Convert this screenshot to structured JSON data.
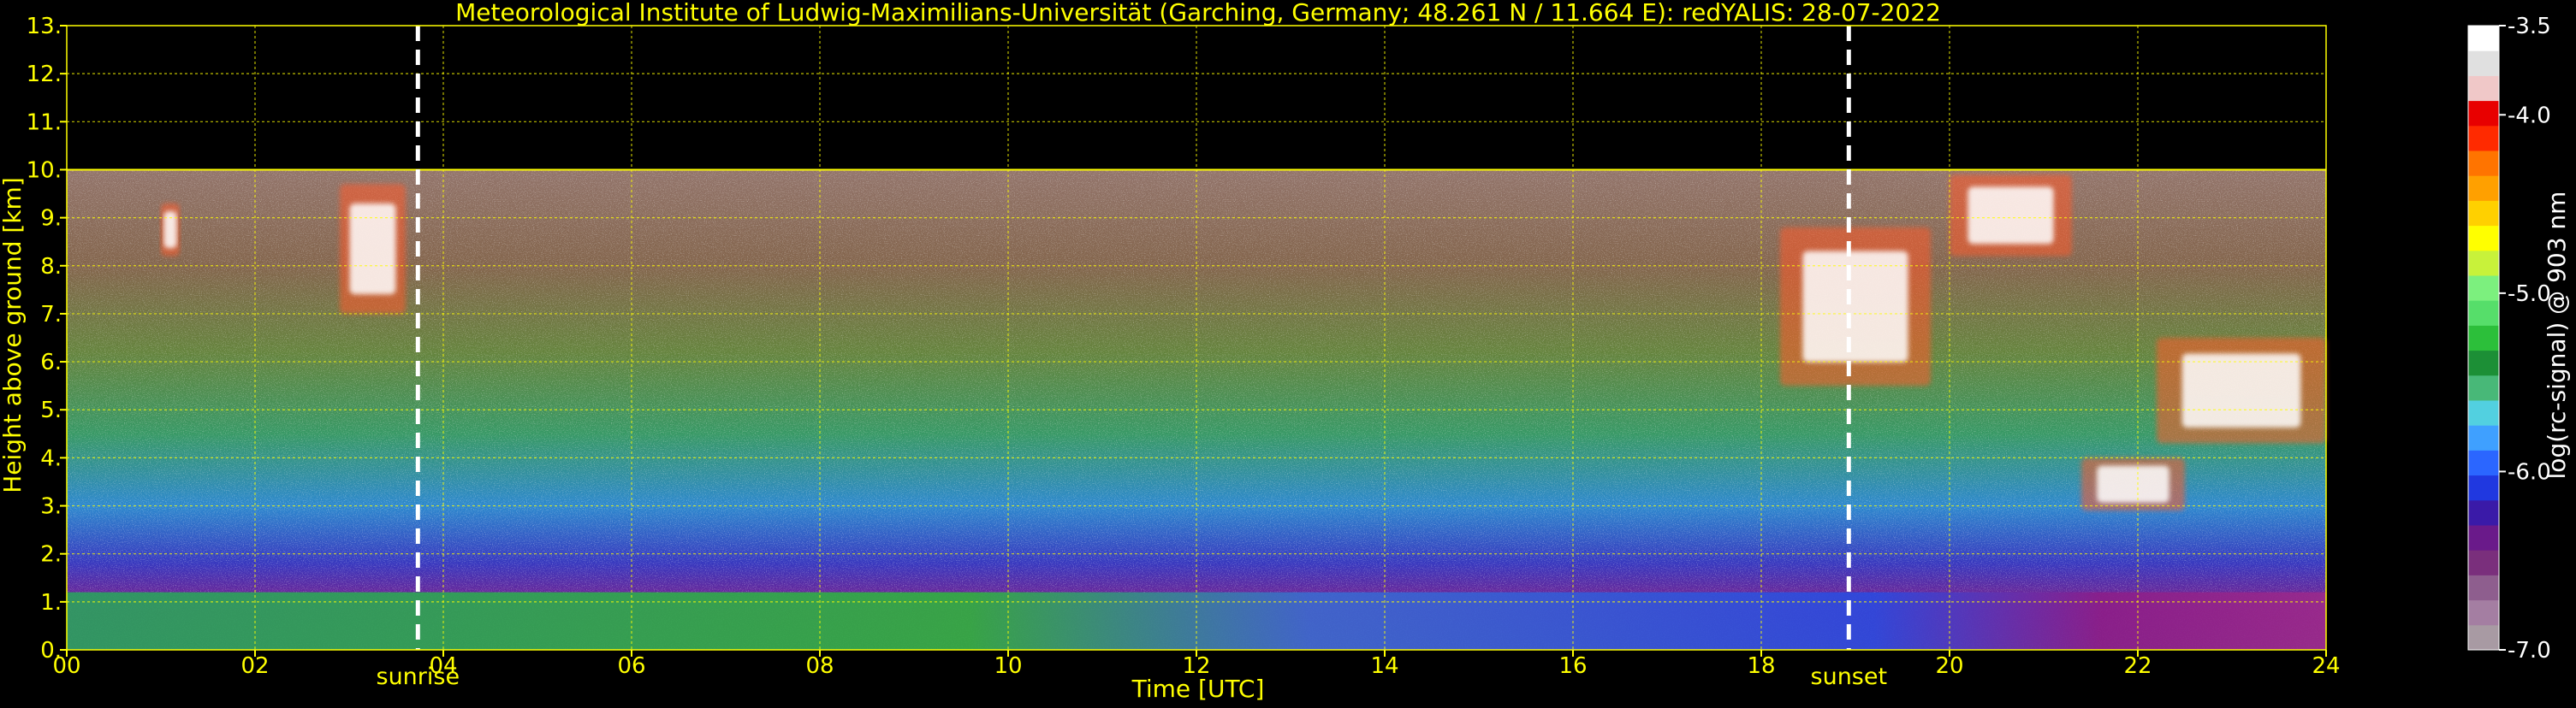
{
  "chart_data": {
    "type": "heatmap",
    "title": "Meteorological Institute of Ludwig-Maximilians-Universität (Garching, Germany; 48.261 N / 11.664 E):    redYALIS: 28-07-2022",
    "xlabel": "Time [UTC]",
    "ylabel": "Height above ground [km]",
    "xlim": [
      0,
      24
    ],
    "ylim": [
      0,
      13
    ],
    "xticks": [
      0,
      2,
      4,
      6,
      8,
      10,
      12,
      14,
      16,
      18,
      20,
      22,
      24
    ],
    "xtick_labels": [
      "00",
      "02",
      "04",
      "06",
      "08",
      "10",
      "12",
      "14",
      "16",
      "18",
      "20",
      "22",
      "24"
    ],
    "yticks": [
      0,
      1,
      2,
      3,
      4,
      5,
      6,
      7,
      8,
      9,
      10,
      11,
      12,
      13
    ],
    "ytick_labels": [
      "0.",
      "1.",
      "2.",
      "3.",
      "4.",
      "5.",
      "6.",
      "7.",
      "8.",
      "9.",
      "10.",
      "11.",
      "12.",
      "13."
    ],
    "grid": true,
    "data_top_km": 10,
    "events": [
      {
        "label": "sunrise",
        "time": 3.73
      },
      {
        "label": "sunset",
        "time": 18.93
      }
    ],
    "features": [
      {
        "kind": "boundary_layer",
        "time_range": [
          0,
          24
        ],
        "height_range": [
          0,
          1.2
        ]
      },
      {
        "kind": "cloud",
        "time_range": [
          1.0,
          1.2
        ],
        "height_range": [
          8.2,
          9.3
        ]
      },
      {
        "kind": "cloud",
        "time_range": [
          2.9,
          3.6
        ],
        "height_range": [
          7.0,
          9.7
        ]
      },
      {
        "kind": "cloud",
        "time_range": [
          18.2,
          19.8
        ],
        "height_range": [
          5.5,
          8.8
        ]
      },
      {
        "kind": "cloud",
        "time_range": [
          20.0,
          21.3
        ],
        "height_range": [
          8.2,
          9.9
        ]
      },
      {
        "kind": "cloud",
        "time_range": [
          21.4,
          22.5
        ],
        "height_range": [
          2.9,
          4.0
        ]
      },
      {
        "kind": "cloud",
        "time_range": [
          22.2,
          24.0
        ],
        "height_range": [
          4.3,
          6.5
        ]
      }
    ],
    "colorbar": {
      "label": "log(rc-signal) @ 903 nm",
      "vmin": -7.0,
      "vmax": -3.5,
      "ticks": [
        -3.5,
        -4.0,
        -5.0,
        -6.0,
        -7.0
      ],
      "tick_labels": [
        "-3.5",
        "-4.0",
        "-5.0",
        "-6.0",
        "-7.0"
      ],
      "colors": [
        "#a89aa3",
        "#a47ea2",
        "#8e5e8e",
        "#7a2f7c",
        "#6a1a8a",
        "#3a1aa8",
        "#2038e0",
        "#2b66ff",
        "#3fa0ff",
        "#52d0e0",
        "#48b878",
        "#1c8f36",
        "#2cbf3a",
        "#56de6a",
        "#7cf07e",
        "#c8f23a",
        "#ffff00",
        "#ffd000",
        "#ffa000",
        "#ff7400",
        "#ff2a00",
        "#e80000",
        "#f0c8c8",
        "#e0e0e0",
        "#ffffff"
      ]
    }
  }
}
